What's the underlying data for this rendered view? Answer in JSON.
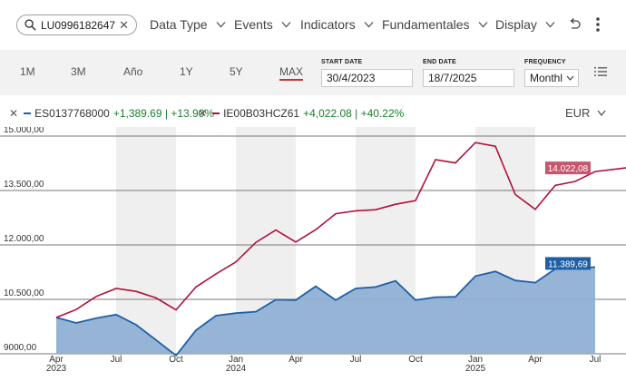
{
  "toolbar": {
    "search_value": "LU0996182647",
    "menus": [
      {
        "label": "Data Type"
      },
      {
        "label": "Events"
      },
      {
        "label": "Indicators"
      },
      {
        "label": "Fundamentales"
      },
      {
        "label": "Display"
      }
    ]
  },
  "controls": {
    "ranges": [
      "1M",
      "3M",
      "Año",
      "1Y",
      "5Y",
      "MAX"
    ],
    "active_range": "MAX",
    "start_date_label": "START DATE",
    "start_date": "30/4/2023",
    "end_date_label": "END DATE",
    "end_date": "18/7/2025",
    "frequency_label": "FREQUENCY",
    "frequency": "Monthl"
  },
  "legend": {
    "series1_name": "ES0137768000",
    "series1_change": "+1,389.69 | +13.90%",
    "series2_name": "IE00B03HCZ61",
    "series2_change": "+4,022.08 | +40.22%",
    "currency": "EUR"
  },
  "colors": {
    "series1": "#1f5fa6",
    "series1_fill": "#8fb0d4",
    "series2": "#b0103a",
    "series2_label_bg": "#c8566f",
    "positive": "#1a7f2e",
    "band": "#efefef"
  },
  "chart_data": {
    "type": "line",
    "ylim": [
      9000,
      15000
    ],
    "yticks": [
      9000,
      10500,
      12000,
      13500,
      15000
    ],
    "ytick_labels": [
      "9000,00",
      "10.500,00",
      "12.000,00",
      "13.500,00",
      "15.000,00"
    ],
    "xtick_labels": [
      {
        "m": "Apr",
        "y": "2023"
      },
      {
        "m": "Jul",
        "y": ""
      },
      {
        "m": "Oct",
        "y": ""
      },
      {
        "m": "Jan",
        "y": "2024"
      },
      {
        "m": "Apr",
        "y": ""
      },
      {
        "m": "Jul",
        "y": ""
      },
      {
        "m": "Oct",
        "y": ""
      },
      {
        "m": "Jan",
        "y": "2025"
      },
      {
        "m": "Apr",
        "y": ""
      },
      {
        "m": "Jul",
        "y": ""
      }
    ],
    "x": [
      "2023-04",
      "2023-05",
      "2023-06",
      "2023-07",
      "2023-08",
      "2023-09",
      "2023-10",
      "2023-11",
      "2023-12",
      "2024-01",
      "2024-02",
      "2024-03",
      "2024-04",
      "2024-05",
      "2024-06",
      "2024-07",
      "2024-08",
      "2024-09",
      "2024-10",
      "2024-11",
      "2024-12",
      "2025-01",
      "2025-02",
      "2025-03",
      "2025-04",
      "2025-05",
      "2025-06",
      "2025-07"
    ],
    "series": [
      {
        "name": "ES0137768000",
        "values": [
          10000,
          9850,
          9980,
          10080,
          9800,
          9380,
          8950,
          9650,
          10050,
          10120,
          10160,
          10490,
          10480,
          10860,
          10480,
          10800,
          10840,
          11010,
          10480,
          10560,
          10570,
          11140,
          11270,
          11020,
          10960,
          11340,
          11350,
          11389.69
        ],
        "end_label": "11.389,69"
      },
      {
        "name": "IE00B03HCZ61",
        "values": [
          10000,
          10220,
          10580,
          10800,
          10720,
          10540,
          10210,
          10840,
          11200,
          11530,
          12070,
          12410,
          12080,
          12420,
          12860,
          12940,
          12970,
          13120,
          13220,
          14350,
          14260,
          14820,
          14720,
          13390,
          12980,
          13640,
          13750,
          14022.08
        ],
        "end_label": "14.022,08"
      }
    ]
  }
}
